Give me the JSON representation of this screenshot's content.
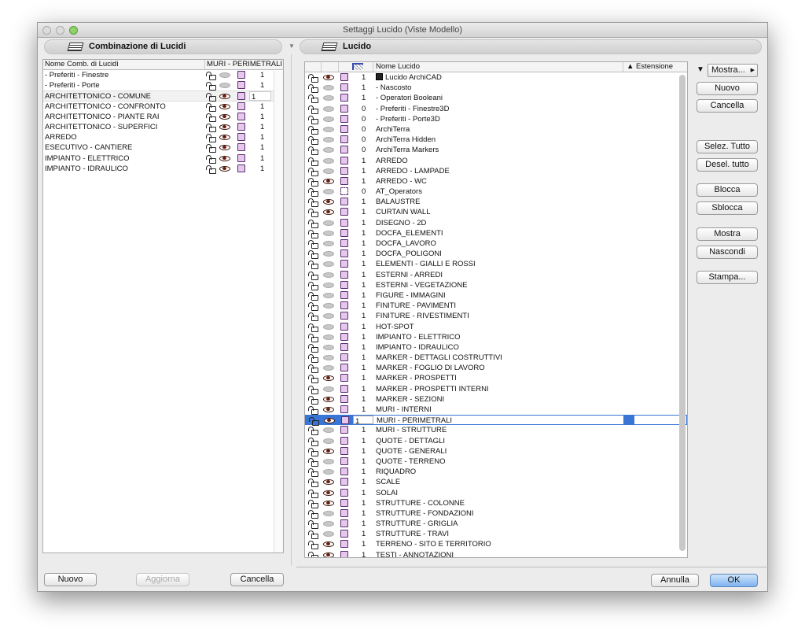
{
  "window": {
    "title": "Settaggi Lucido (Viste Modello)"
  },
  "left": {
    "header": "Combinazione di Lucidi",
    "col_name": "Nome Comb. di Lucidi",
    "col_layer": "MURI - PERIMETRALI",
    "rows": [
      {
        "name": "- Preferiti - Finestre",
        "visible": false,
        "value": "1"
      },
      {
        "name": "- Preferiti - Porte",
        "visible": false,
        "value": "1"
      },
      {
        "name": "ARCHITETTONICO - COMUNE",
        "visible": true,
        "value": "1",
        "selected": true
      },
      {
        "name": "ARCHITETTONICO - CONFRONTO",
        "visible": true,
        "value": "1"
      },
      {
        "name": "ARCHITETTONICO - PIANTE RAI",
        "visible": true,
        "value": "1"
      },
      {
        "name": "ARCHITETTONICO - SUPERFICI",
        "visible": true,
        "value": "1"
      },
      {
        "name": "ARREDO",
        "visible": true,
        "value": "1"
      },
      {
        "name": "ESECUTIVO - CANTIERE",
        "visible": true,
        "value": "1"
      },
      {
        "name": "IMPIANTO - ELETTRICO",
        "visible": true,
        "value": "1"
      },
      {
        "name": "IMPIANTO - IDRAULICO",
        "visible": true,
        "value": "1"
      }
    ],
    "buttons": {
      "new": "Nuovo",
      "update": "Aggiorna",
      "delete": "Cancella"
    }
  },
  "right": {
    "header": "Lucido",
    "col_name": "Nome Lucido",
    "col_ext": "▲ Estensione",
    "rows": [
      {
        "name": "Lucido ArchiCAD",
        "v": true,
        "n": "1",
        "locked": true
      },
      {
        "name": "- Nascosto",
        "v": false,
        "n": "1"
      },
      {
        "name": "- Operatori Booleani",
        "v": false,
        "n": "1"
      },
      {
        "name": "- Preferiti - Finestre3D",
        "v": false,
        "n": "0"
      },
      {
        "name": "- Preferiti - Porte3D",
        "v": false,
        "n": "0"
      },
      {
        "name": "ArchiTerra",
        "v": false,
        "n": "0"
      },
      {
        "name": "ArchiTerra Hidden",
        "v": false,
        "n": "0"
      },
      {
        "name": "ArchiTerra Markers",
        "v": false,
        "n": "0"
      },
      {
        "name": "ARREDO",
        "v": false,
        "n": "1"
      },
      {
        "name": "ARREDO - LAMPADE",
        "v": false,
        "n": "1"
      },
      {
        "name": "ARREDO - WC",
        "v": true,
        "n": "1"
      },
      {
        "name": "AT_Operators",
        "v": false,
        "n": "0",
        "alt": true
      },
      {
        "name": "BALAUSTRE",
        "v": true,
        "n": "1"
      },
      {
        "name": "CURTAIN WALL",
        "v": true,
        "n": "1"
      },
      {
        "name": "DISEGNO - 2D",
        "v": false,
        "n": "1"
      },
      {
        "name": "DOCFA_ELEMENTI",
        "v": false,
        "n": "1"
      },
      {
        "name": "DOCFA_LAVORO",
        "v": false,
        "n": "1"
      },
      {
        "name": "DOCFA_POLIGONI",
        "v": false,
        "n": "1"
      },
      {
        "name": "ELEMENTI - GIALLI E ROSSI",
        "v": false,
        "n": "1"
      },
      {
        "name": "ESTERNI - ARREDI",
        "v": false,
        "n": "1"
      },
      {
        "name": "ESTERNI - VEGETAZIONE",
        "v": false,
        "n": "1"
      },
      {
        "name": "FIGURE - IMMAGINI",
        "v": false,
        "n": "1"
      },
      {
        "name": "FINITURE - PAVIMENTI",
        "v": false,
        "n": "1"
      },
      {
        "name": "FINITURE - RIVESTIMENTI",
        "v": false,
        "n": "1"
      },
      {
        "name": "HOT-SPOT",
        "v": false,
        "n": "1"
      },
      {
        "name": "IMPIANTO - ELETTRICO",
        "v": false,
        "n": "1"
      },
      {
        "name": "IMPIANTO - IDRAULICO",
        "v": false,
        "n": "1"
      },
      {
        "name": "MARKER - DETTAGLI COSTRUTTIVI",
        "v": false,
        "n": "1"
      },
      {
        "name": "MARKER - FOGLIO DI LAVORO",
        "v": false,
        "n": "1"
      },
      {
        "name": "MARKER - PROSPETTI",
        "v": true,
        "n": "1"
      },
      {
        "name": "MARKER - PROSPETTI INTERNI",
        "v": false,
        "n": "1"
      },
      {
        "name": "MARKER - SEZIONI",
        "v": true,
        "n": "1"
      },
      {
        "name": "MURI - INTERNI",
        "v": true,
        "n": "1"
      },
      {
        "name": "MURI - PERIMETRALI",
        "v": true,
        "n": "1",
        "selected": true
      },
      {
        "name": "MURI - STRUTTURE",
        "v": false,
        "n": "1"
      },
      {
        "name": "QUOTE - DETTAGLI",
        "v": false,
        "n": "1"
      },
      {
        "name": "QUOTE - GENERALI",
        "v": true,
        "n": "1"
      },
      {
        "name": "QUOTE - TERRENO",
        "v": false,
        "n": "1"
      },
      {
        "name": "RIQUADRO",
        "v": false,
        "n": "1"
      },
      {
        "name": "SCALE",
        "v": true,
        "n": "1"
      },
      {
        "name": "SOLAI",
        "v": true,
        "n": "1"
      },
      {
        "name": "STRUTTURE - COLONNE",
        "v": true,
        "n": "1"
      },
      {
        "name": "STRUTTURE - FONDAZIONI",
        "v": false,
        "n": "1"
      },
      {
        "name": "STRUTTURE - GRIGLIA",
        "v": false,
        "n": "1"
      },
      {
        "name": "STRUTTURE - TRAVI",
        "v": false,
        "n": "1"
      },
      {
        "name": "TERRENO - SITO E TERRITORIO",
        "v": true,
        "n": "1"
      },
      {
        "name": "TESTI - ANNOTAZIONI",
        "v": true,
        "n": "1"
      }
    ],
    "side": {
      "show": "Mostra...",
      "new": "Nuovo",
      "delete": "Cancella",
      "select_all": "Selez. Tutto",
      "deselect_all": "Desel. tutto",
      "lock": "Blocca",
      "unlock": "Sblocca",
      "show_btn": "Mostra",
      "hide": "Nascondi",
      "print": "Stampa..."
    }
  },
  "footer": {
    "cancel": "Annulla",
    "ok": "OK"
  },
  "colors": {
    "selection": "#3875d7",
    "eye": "#6b1a0a",
    "layer_icon": "#5a2a70"
  }
}
